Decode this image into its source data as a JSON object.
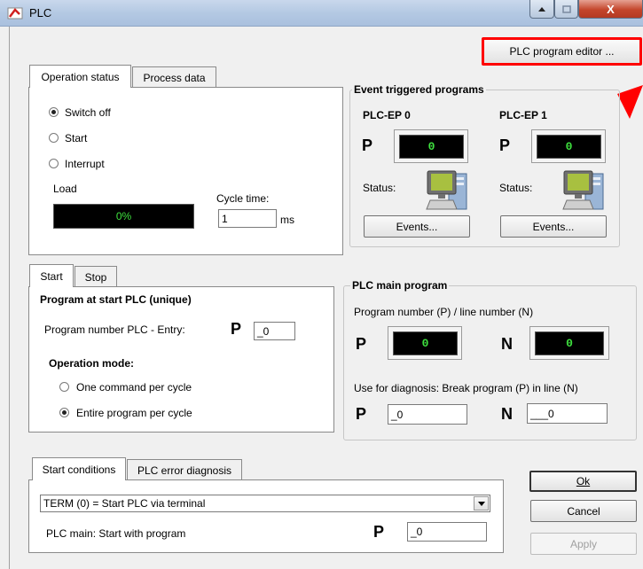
{
  "window": {
    "title": "PLC",
    "close_glyph": "X"
  },
  "top": {
    "editor_button": "PLC program editor ..."
  },
  "operation": {
    "tabs": [
      "Operation status",
      "Process data"
    ],
    "radios": [
      {
        "label": "Switch off",
        "checked": true
      },
      {
        "label": "Start",
        "checked": false
      },
      {
        "label": "Interrupt",
        "checked": false
      }
    ],
    "load_label": "Load",
    "load_value": "0%",
    "cycle_label": "Cycle time:",
    "cycle_value": "1",
    "cycle_unit": "ms"
  },
  "events": {
    "legend": "Event triggered programs",
    "ep0_title": "PLC-EP 0",
    "ep1_title": "PLC-EP 1",
    "p_label": "P",
    "ep0_value": "0",
    "ep1_value": "0",
    "status_label": "Status:",
    "events_button": "Events..."
  },
  "start_panel": {
    "tabs": [
      "Start",
      "Stop"
    ],
    "heading": "Program at start PLC (unique)",
    "entry_label": "Program number PLC - Entry:",
    "p_label": "P",
    "entry_value": "_0",
    "mode_heading": "Operation mode:",
    "modes": [
      {
        "label": "One command per cycle",
        "checked": false
      },
      {
        "label": "Entire program per cycle",
        "checked": true
      }
    ]
  },
  "main_program": {
    "legend": "PLC main program",
    "pn_label": "Program number (P) / line number (N)",
    "p_label": "P",
    "n_label": "N",
    "p_value": "0",
    "n_value": "0",
    "diag_label": "Use for diagnosis: Break program (P) in line (N)",
    "diag_p_value": "_0",
    "diag_n_value": "___0"
  },
  "conditions": {
    "tabs": [
      "Start conditions",
      "PLC error diagnosis"
    ],
    "select_value": "TERM (0) = Start PLC via terminal",
    "main_label": "PLC main: Start with program",
    "p_label": "P",
    "p_value": "_0"
  },
  "dialog_buttons": {
    "ok": "Ok",
    "cancel": "Cancel",
    "apply": "Apply"
  },
  "colors": {
    "display_text": "#3ee03e",
    "highlight": "#ff0000"
  }
}
